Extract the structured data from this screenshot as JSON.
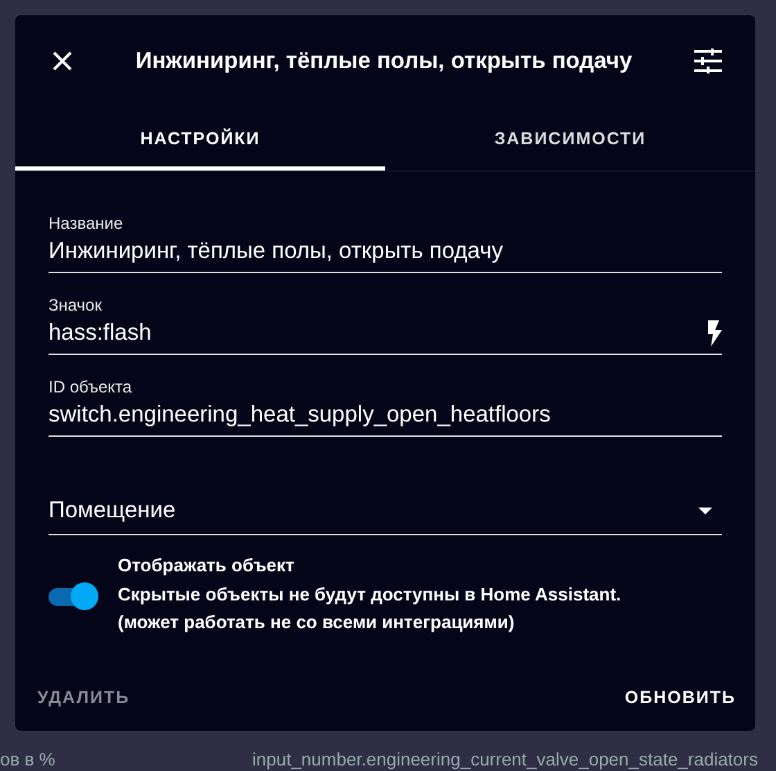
{
  "dialog": {
    "title": "Инжиниринг, тёплые полы, открыть подачу",
    "tabs": [
      {
        "label": "НАСТРОЙКИ",
        "selected": true
      },
      {
        "label": "ЗАВИСИМОСТИ",
        "selected": false
      }
    ],
    "fields": [
      {
        "kind": "text",
        "label": "Название",
        "value": "Инжиниринг, тёплые полы, открыть подачу"
      },
      {
        "kind": "icon",
        "label": "Значок",
        "value": "hass:flash"
      },
      {
        "kind": "text",
        "label": "ID объекта",
        "value": "switch.engineering_heat_supply_open_heatfloors"
      },
      {
        "kind": "select",
        "placeholder": "Помещение"
      }
    ],
    "visibility": {
      "label": "Отображать объект",
      "on": true,
      "description": [
        "Скрытые объекты не будут доступны в Home Assistant.",
        "(может работать не со всеми интеграциями)"
      ]
    },
    "buttons": [
      {
        "kind": "delete",
        "label": "УДАЛИТЬ"
      },
      {
        "kind": "update",
        "label": "ОБНОВИТЬ"
      }
    ]
  },
  "background_row": {
    "column_1": "ов в %",
    "column_2": "input_number.engineering_current_valve_open_state_radiators"
  }
}
